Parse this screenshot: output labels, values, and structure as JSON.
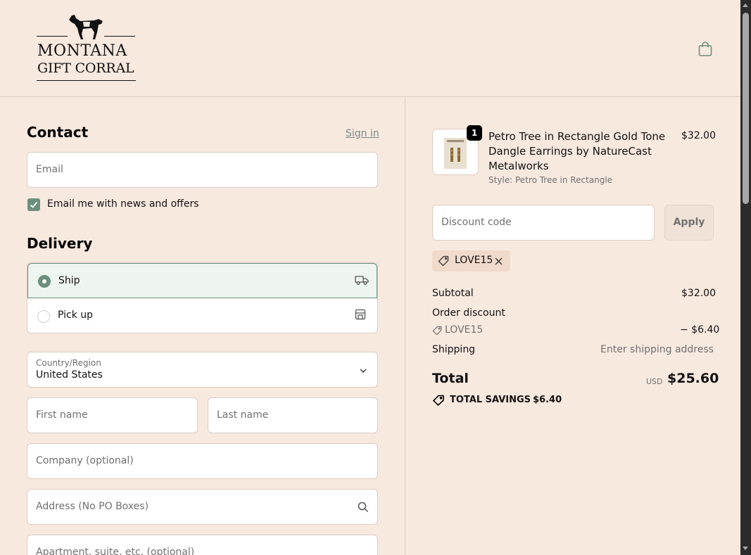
{
  "brand": {
    "line1": "MONTANA",
    "line2": "GIFT CORRAL"
  },
  "contact": {
    "heading": "Contact",
    "sign_in": "Sign in",
    "email_placeholder": "Email",
    "newsletter_label": "Email me with news and offers",
    "newsletter_checked": true
  },
  "delivery": {
    "heading": "Delivery",
    "options": [
      {
        "label": "Ship",
        "selected": true,
        "icon": "truck-icon"
      },
      {
        "label": "Pick up",
        "selected": false,
        "icon": "store-icon"
      }
    ],
    "country_label": "Country/Region",
    "country_value": "United States",
    "first_name": "First name",
    "last_name": "Last name",
    "company": "Company (optional)",
    "address": "Address (No PO Boxes)",
    "apartment": "Apartment, suite, etc. (optional)"
  },
  "order": {
    "item": {
      "quantity": "1",
      "title_lines": [
        "Petro Tree in Rectangle Gold Tone",
        "Dangle Earrings by NatureCast",
        "Metalworks"
      ],
      "variant": "Style: Petro Tree in Rectangle",
      "price": "$32.00"
    },
    "discount_placeholder": "Discount code",
    "apply_label": "Apply",
    "applied_code": "LOVE15",
    "subtotal_label": "Subtotal",
    "subtotal_value": "$32.00",
    "order_discount_label": "Order discount",
    "discount_code": "LOVE15",
    "discount_value": "− $6.40",
    "shipping_label": "Shipping",
    "shipping_value": "Enter shipping address",
    "total_label": "Total",
    "currency": "USD",
    "total_value": "$25.60",
    "savings_label": "TOTAL SAVINGS",
    "savings_value": "$6.40"
  },
  "colors": {
    "background": "#f8e9df",
    "accent": "#6b8f7d",
    "border": "#dcccc2"
  }
}
